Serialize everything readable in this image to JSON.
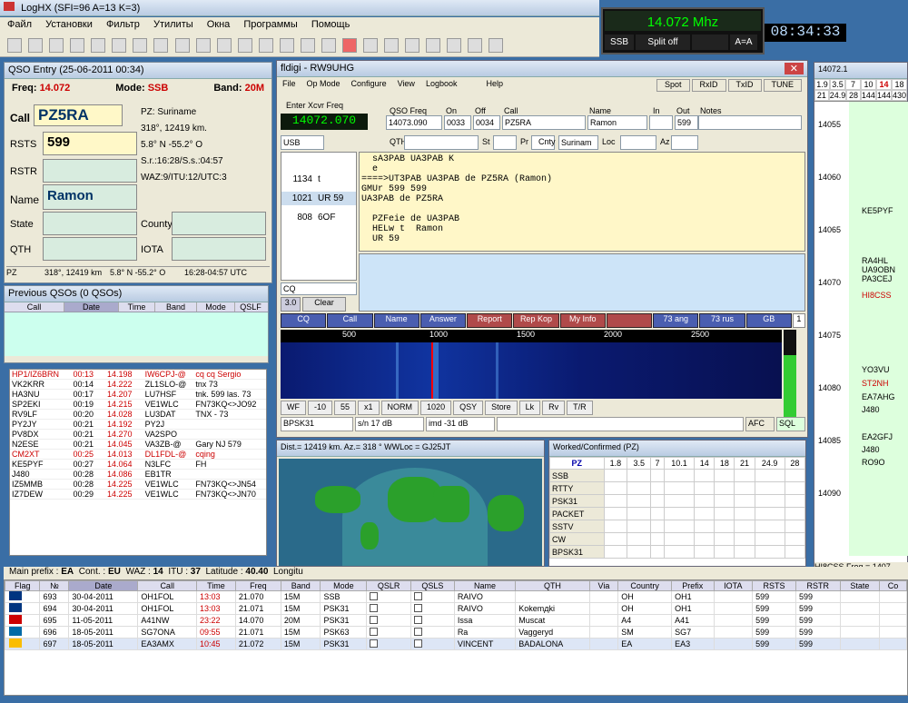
{
  "app_title": "LogHX (SFI=96 A=13 K=3)",
  "menu": [
    "Файл",
    "Установки",
    "Фильтр",
    "Утилиты",
    "Окна",
    "Программы",
    "Помощь"
  ],
  "radio": {
    "freq": "14.072 Mhz",
    "mode": "SSB",
    "split": "Split off",
    "ab": "A=A",
    "clock": "08:34:33"
  },
  "qso_entry": {
    "title": "QSO Entry (25-06-2011 00:34)",
    "freq_label": "Freq:",
    "freq": "14.072",
    "mode_label": "Mode:",
    "mode": "SSB",
    "band_label": "Band:",
    "band": "20M",
    "call_label": "Call",
    "call": "PZ5RA",
    "rsts_label": "RSTS",
    "rsts": "599",
    "rstr_label": "RSTR",
    "name_label": "Name",
    "name": "Ramon",
    "state_label": "State",
    "county_label": "County",
    "qth_label": "QTH",
    "iota_label": "IOTA",
    "info1": "PZ: Suriname",
    "info2": "318°, 12419 km.",
    "info3": "5.8° N  -55.2° O",
    "info4": "S.r.:16:28/S.s.:04:57",
    "info5": "WAZ:9/ITU:12/UTC:3",
    "status": [
      "PZ",
      "318°, 12419 km",
      "5.8° N  -55.2° O",
      "16:28-04:57 UTC"
    ]
  },
  "prev_qsos": {
    "title": "Previous QSOs (0 QSOs)",
    "headers": [
      "Call",
      "Date",
      "Time",
      "Band",
      "Mode",
      "QSLF"
    ]
  },
  "spots": [
    [
      "HP1/IZ6BRN",
      "00:13",
      "14.198",
      "IW6CPJ-@",
      "cq cq  Sergio"
    ],
    [
      "VK2KRR",
      "00:14",
      "14.222",
      "ZL1SLO-@",
      "tnx 73"
    ],
    [
      "HA3NU",
      "00:17",
      "14.207",
      "LU7HSF",
      "tnk. 599 las. 73"
    ],
    [
      "SP2EKI",
      "00:19",
      "14.215",
      "VE1WLC",
      "FN73KQ<>JO92"
    ],
    [
      "RV9LF",
      "00:20",
      "14.028",
      "LU3DAT",
      "TNX - 73"
    ],
    [
      "PY2JY",
      "00:21",
      "14.192",
      "PY2J",
      ""
    ],
    [
      "PV8DX",
      "00:21",
      "14.270",
      "VA2SPO",
      ""
    ],
    [
      "N2ESE",
      "00:21",
      "14.045",
      "VA3ZB-@",
      "Gary NJ 579"
    ],
    [
      "CM2XT",
      "00:25",
      "14.013",
      "DL1FDL-@",
      "cqing"
    ],
    [
      "KE5PYF",
      "00:27",
      "14.064",
      "N3LFC",
      "FH"
    ],
    [
      "J480",
      "00:28",
      "14.086",
      "EB1TR",
      ""
    ],
    [
      "IZ5MMB",
      "00:28",
      "14.225",
      "VE1WLC",
      "FN73KQ<>JN54"
    ],
    [
      "IZ7DEW",
      "00:29",
      "14.225",
      "VE1WLC",
      "FN73KQ<>JN70"
    ]
  ],
  "fldigi": {
    "title": "fldigi - RW9UHG",
    "menu": [
      "File",
      "Op Mode",
      "Configure",
      "View",
      "Logbook",
      "Help"
    ],
    "tabs": [
      "Spot",
      "RxID",
      "TxID",
      "TUNE"
    ],
    "freq": "14072.070",
    "qso_freq": "14073.090",
    "on": "0033",
    "off": "0034",
    "call": "PZ5RA",
    "name": "Ramon",
    "in": "",
    "out": "599",
    "lbl_xcvr": "Enter Xcvr Freq",
    "lbl_qsofreq": "QSO Freq",
    "lbl_on": "On",
    "lbl_off": "Off",
    "lbl_call": "Call",
    "lbl_name": "Name",
    "lbl_in": "In",
    "lbl_out": "Out",
    "lbl_notes": "Notes",
    "mode_sel": "USB",
    "lbl_qth": "QTH",
    "qth": "",
    "lbl_st": "St",
    "lbl_pr": "Pr",
    "lbl_cnty": "Cnty",
    "cnty": "Surinam",
    "lbl_loc": "Loc",
    "lbl_az": "Az",
    "list": [
      [
        "1134",
        "t"
      ],
      [
        "1021",
        "UR 59"
      ],
      [
        "808",
        "6OF"
      ]
    ],
    "rx_text": "  sA3PAB UA3PAB K\n  e\n====>UT3PAB UA3PAB de PZ5RA (Ramon)\nGMUr 599 599\nUA3PAB de PZ5RA\n\n  PZFeie de UA3PAB\n  HELw t  Ramon\n  UR 59",
    "cq_field": "CQ",
    "val30": "3.0",
    "clear": "Clear",
    "macros": [
      "CQ",
      "Call",
      "Name",
      "Answer",
      "Report",
      "Rep Kop",
      "My Info",
      "",
      "73 ang",
      "73 rus",
      "GB"
    ],
    "macro_page": "1",
    "scale": [
      "500",
      "1000",
      "1500",
      "2000",
      "2500"
    ],
    "ctl": [
      "WF",
      "-10",
      "55",
      "x1",
      "NORM",
      "1020",
      "QSY",
      "Store",
      "Lk",
      "Rv",
      "T/R"
    ],
    "status": [
      "BPSK31",
      "s/n 17 dB",
      "imd -31 dB",
      "AFC",
      "SQL"
    ]
  },
  "map": {
    "title": "Dist.= 12419 km.  Az.= 318 °  WWLoc = GJ25JT"
  },
  "worked": {
    "title": "Worked/Confirmed (PZ)",
    "bands": [
      "PZ",
      "1.8",
      "3.5",
      "7",
      "10.1",
      "14",
      "18",
      "21",
      "24.9",
      "28"
    ],
    "modes": [
      "SSB",
      "RTTY",
      "PSK31",
      "PACKET",
      "SSTV",
      "CW",
      "BPSK31"
    ]
  },
  "bandmap": {
    "title": "14072.1",
    "top": [
      "1.9",
      "3.5",
      "7",
      "10",
      "14",
      "18"
    ],
    "top2": [
      "21",
      "24.9",
      "28",
      "144",
      "144",
      "430"
    ],
    "ticks": [
      "14055",
      "14060",
      "14065",
      "14070",
      "14075",
      "14080",
      "14085",
      "14090"
    ],
    "spots": [
      "KE5PYF",
      "RA4HL",
      "UA9OBN",
      "PA3CEJ",
      "HI8CSS",
      "YO3VU",
      "ST2NH",
      "EA7AHG",
      "J480",
      "EA2GFJ",
      "J480",
      "RO9O"
    ],
    "status": "HI8CSS  Freq = 1407"
  },
  "prefix_bar": {
    "main_prefix_label": "Main prefix :",
    "main_prefix": "EA",
    "cont_label": "Cont. :",
    "cont": "EU",
    "waz_label": "WAZ :",
    "waz": "14",
    "itu_label": "ITU :",
    "itu": "37",
    "lat_label": "Latitude :",
    "lat": "40.40",
    "lon_label": "Longitu"
  },
  "log": {
    "headers": [
      "Flag",
      "№",
      "Date",
      "Call",
      "Time",
      "Freq",
      "Band",
      "Mode",
      "QSLR",
      "QSLS",
      "Name",
      "QTH",
      "Via",
      "Country",
      "Prefix",
      "IOTA",
      "RSTS",
      "RSTR",
      "State",
      "Co"
    ],
    "rows": [
      [
        "693",
        "30-04-2011",
        "OH1FOL",
        "13:03",
        "21.070",
        "15M",
        "SSB",
        "RAIVO",
        "",
        "",
        "OH",
        "OH1",
        "599",
        "599"
      ],
      [
        "694",
        "30-04-2011",
        "OH1FOL",
        "13:03",
        "21.071",
        "15M",
        "PSK31",
        "RAIVO",
        "Kokemдki",
        "",
        "OH",
        "OH1",
        "599",
        "599"
      ],
      [
        "695",
        "11-05-2011",
        "A41NW",
        "23:22",
        "14.070",
        "20M",
        "PSK31",
        "Issa",
        "Muscat",
        "",
        "A4",
        "A41",
        "599",
        "599"
      ],
      [
        "696",
        "18-05-2011",
        "SG7ONA",
        "09:55",
        "21.071",
        "15M",
        "PSK63",
        "Ra",
        "Vaggeryd",
        "",
        "SM",
        "SG7",
        "599",
        "599"
      ],
      [
        "697",
        "18-05-2011",
        "EA3AMX",
        "10:45",
        "21.072",
        "15M",
        "PSK31",
        "VINCENT",
        "BADALONA",
        "",
        "EA",
        "EA3",
        "599",
        "599"
      ]
    ]
  },
  "colors": {
    "accent": "#c00000",
    "dark": "#101010",
    "green": "#00ff00"
  }
}
